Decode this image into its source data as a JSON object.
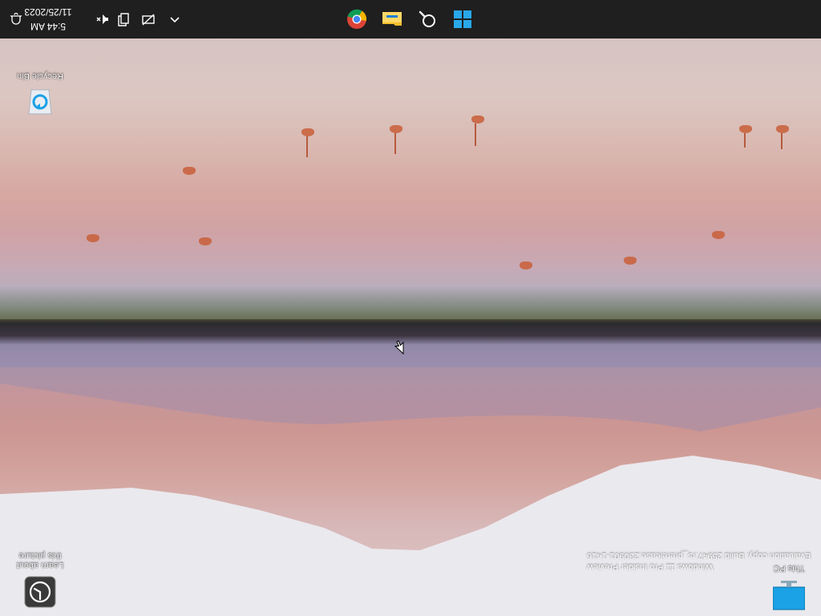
{
  "desktop": {
    "icons": [
      {
        "label": "This PC",
        "icon": "this-pc-icon"
      },
      {
        "label": "Learn about this picture",
        "icon": "learn-about-picture-icon"
      },
      {
        "label": "Recycle Bin",
        "icon": "recycle-bin-icon"
      }
    ],
    "watermark": {
      "line1": "Windows 11 Pro Insider Preview",
      "line2": "Evaluation copy. Build 25947.rs_prerelease.230901-1416"
    }
  },
  "taskbar": {
    "pinned": [
      {
        "name": "Start",
        "icon": "windows-start-icon"
      },
      {
        "name": "Search",
        "icon": "search-icon"
      },
      {
        "name": "File Explorer",
        "icon": "file-explorer-icon"
      },
      {
        "name": "Google Chrome",
        "icon": "chrome-icon"
      }
    ],
    "tray": {
      "icons": [
        "chevron-up-icon",
        "network-disconnected-icon",
        "copy-icon",
        "speaker-muted-icon"
      ],
      "time": "5:44 AM",
      "date": "11/25/2023",
      "notification_icon": "notification-bell-icon"
    }
  },
  "colors": {
    "taskbar_bg": "#1f1f1f",
    "accent_blue": "#1aa1e6"
  }
}
